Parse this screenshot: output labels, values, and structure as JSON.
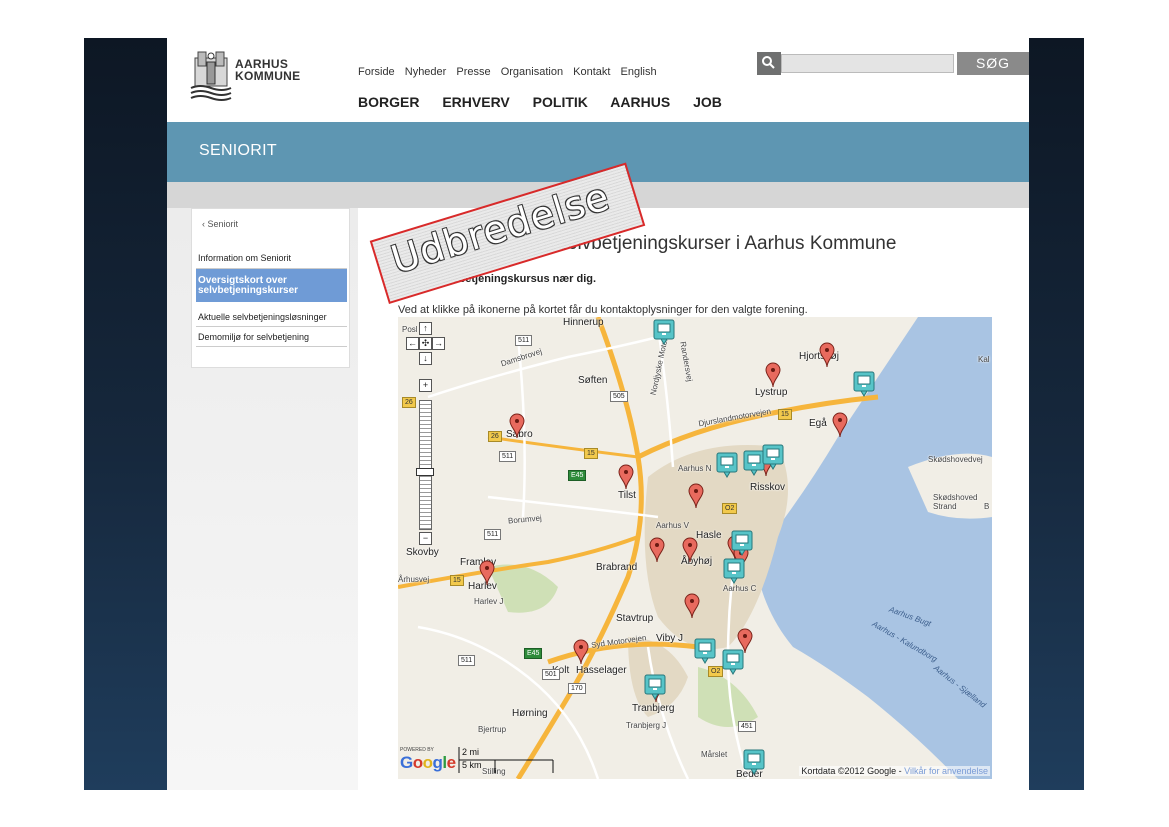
{
  "logo": {
    "line1": "AARHUS",
    "line2": "KOMMUNE"
  },
  "topnav": [
    "Forside",
    "Nyheder",
    "Presse",
    "Organisation",
    "Kontakt",
    "English"
  ],
  "mainnav": [
    "BORGER",
    "ERHVERV",
    "POLITIK",
    "AARHUS",
    "JOB"
  ],
  "search": {
    "button_label": "SØG",
    "value": ""
  },
  "banner": {
    "title": "SENIORIT"
  },
  "sidenav": {
    "back": "‹ Seniorit",
    "items": [
      {
        "label": "Information om Seniorit"
      },
      {
        "label": "Oversigtskort over selvbetjeningskurser"
      },
      {
        "label": "Aktuelle selvbetjeningsløsninger"
      },
      {
        "label": "Demomiljø for selvbetjening"
      }
    ]
  },
  "content": {
    "title": "Oversigtskort over selvbetjeningskurser i Aarhus Kommune",
    "subhead": "Find et selvbetjeningskursus nær dig.",
    "intro": "Ved at klikke på ikonerne på kortet får du kontaktoplysninger for den valgte forening."
  },
  "stamp": {
    "text": "Udbredelse"
  },
  "map": {
    "attribution": "Kortdata ©2012 Google -",
    "terms_link": "Vilkår for anvendelse",
    "scale_mi": "2 mi",
    "scale_km": "5 km",
    "powered_by": "POWERED BY",
    "google": [
      "G",
      "o",
      "o",
      "g",
      "l",
      "e"
    ],
    "colors": {
      "land": "#f1eee6",
      "water": "#a9c4e3",
      "urban": "#e3d9c4",
      "motorway": "#f6b53c",
      "road": "#ffffff",
      "forest": "#cfe0b6"
    },
    "labels": [
      {
        "text": "Hinnerup",
        "cls": ""
      },
      {
        "text": "Søften",
        "cls": ""
      },
      {
        "text": "Lystrup",
        "cls": ""
      },
      {
        "text": "Hjortshøj",
        "cls": ""
      },
      {
        "text": "Egå",
        "cls": ""
      },
      {
        "text": "Sabro",
        "cls": ""
      },
      {
        "text": "Tilst",
        "cls": ""
      },
      {
        "text": "Aarhus N",
        "cls": "small"
      },
      {
        "text": "Risskov",
        "cls": ""
      },
      {
        "text": "Aarhus V",
        "cls": "small"
      },
      {
        "text": "Hasle",
        "cls": ""
      },
      {
        "text": "Brabrand",
        "cls": ""
      },
      {
        "text": "Åbyhøj",
        "cls": ""
      },
      {
        "text": "Aarhus C",
        "cls": "small"
      },
      {
        "text": "Skovby",
        "cls": ""
      },
      {
        "text": "Harlev",
        "cls": ""
      },
      {
        "text": "Harlev J",
        "cls": "small"
      },
      {
        "text": "Framlev",
        "cls": ""
      },
      {
        "text": "Stavtrup",
        "cls": ""
      },
      {
        "text": "Viby J",
        "cls": ""
      },
      {
        "text": "Kolt",
        "cls": ""
      },
      {
        "text": "Hasselager",
        "cls": ""
      },
      {
        "text": "Tranbjerg",
        "cls": ""
      },
      {
        "text": "Tranbjerg J",
        "cls": "small"
      },
      {
        "text": "Hørning",
        "cls": ""
      },
      {
        "text": "Bjertrup",
        "cls": "small"
      },
      {
        "text": "Mårslet",
        "cls": "small"
      },
      {
        "text": "Beder",
        "cls": ""
      },
      {
        "text": "Skødshovedvej",
        "cls": "small"
      },
      {
        "text": "Skødshoved Strand",
        "cls": "small"
      },
      {
        "text": "Aarhus Bugt",
        "cls": "water"
      },
      {
        "text": "Aarhus - Kalundborg",
        "cls": "water"
      },
      {
        "text": "Aarhus - Sjælland",
        "cls": "water"
      },
      {
        "text": "Djurslandmotorvejen",
        "cls": "small"
      },
      {
        "text": "Syd Motorvejen",
        "cls": "small"
      },
      {
        "text": "Borumvej",
        "cls": "small"
      },
      {
        "text": "Århusvej",
        "cls": "small"
      },
      {
        "text": "Damsbrovej",
        "cls": "small"
      },
      {
        "text": "Nordjyske Motorvej",
        "cls": "small"
      },
      {
        "text": "Randersvej",
        "cls": "small"
      },
      {
        "text": "Stilling",
        "cls": "small"
      },
      {
        "text": "Posl",
        "cls": "small"
      },
      {
        "text": "Kal",
        "cls": "small"
      },
      {
        "text": "B",
        "cls": "small"
      }
    ],
    "shields": [
      {
        "text": "511",
        "cls": ""
      },
      {
        "text": "505",
        "cls": ""
      },
      {
        "text": "26",
        "cls": "yellow"
      },
      {
        "text": "26",
        "cls": "yellow"
      },
      {
        "text": "511",
        "cls": ""
      },
      {
        "text": "15",
        "cls": "yellow"
      },
      {
        "text": "E45",
        "cls": "green"
      },
      {
        "text": "15",
        "cls": "yellow"
      },
      {
        "text": "15",
        "cls": "yellow"
      },
      {
        "text": "O2",
        "cls": "yellow"
      },
      {
        "text": "511",
        "cls": ""
      },
      {
        "text": "511",
        "cls": ""
      },
      {
        "text": "E45",
        "cls": "green"
      },
      {
        "text": "501",
        "cls": ""
      },
      {
        "text": "170",
        "cls": ""
      },
      {
        "text": "451",
        "cls": ""
      },
      {
        "text": "O2",
        "cls": "yellow"
      }
    ]
  }
}
